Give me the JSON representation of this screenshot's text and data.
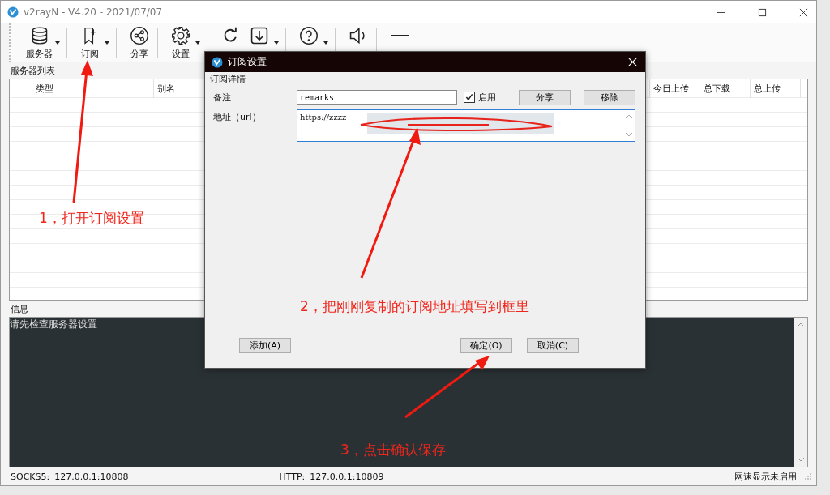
{
  "window": {
    "title": "v2rayN - V4.20 - 2021/07/07"
  },
  "toolbar": [
    {
      "kind": "database",
      "label": "服务器",
      "dropdown": true
    },
    {
      "kind": "bookmark",
      "label": "订阅",
      "dropdown": true
    },
    {
      "kind": "share",
      "label": "分享",
      "dropdown": false
    },
    {
      "kind": "gear",
      "label": "设置",
      "dropdown": true
    },
    {
      "kind": "refresh",
      "dropdown": false
    },
    {
      "kind": "download",
      "dropdown": true
    },
    {
      "kind": "help",
      "dropdown": true
    },
    {
      "kind": "speaker",
      "dropdown": false
    },
    {
      "kind": "minus",
      "dropdown": false
    }
  ],
  "server_list": {
    "label": "服务器列表",
    "columns": [
      "类型",
      "别名",
      "今日上传",
      "总下载",
      "总上传"
    ]
  },
  "log": {
    "label": "信息",
    "lines": [
      "请先检查服务器设置"
    ]
  },
  "status_bar": {
    "socks_label": "SOCKS5:",
    "socks": "127.0.0.1:10808",
    "http_label": "HTTP:",
    "http": "127.0.0.1:10809",
    "speed": "网速显示未启用"
  },
  "dialog": {
    "title": "订阅设置",
    "group": "订阅详情",
    "remarks_label": "备注",
    "remarks": "remarks",
    "enabled": {
      "label": "启用",
      "checked": true
    },
    "share_button": "分享",
    "remove_button": "移除",
    "url_label": "地址（url）",
    "url": "https://zzzz",
    "add_button": "添加(A)",
    "ok_button": "确定(O)",
    "cancel_button": "取消(C)"
  },
  "annotations": [
    "1，打开订阅设置",
    "2，把刚刚复制的订阅地址填写到框里",
    "3，点击确认保存"
  ]
}
